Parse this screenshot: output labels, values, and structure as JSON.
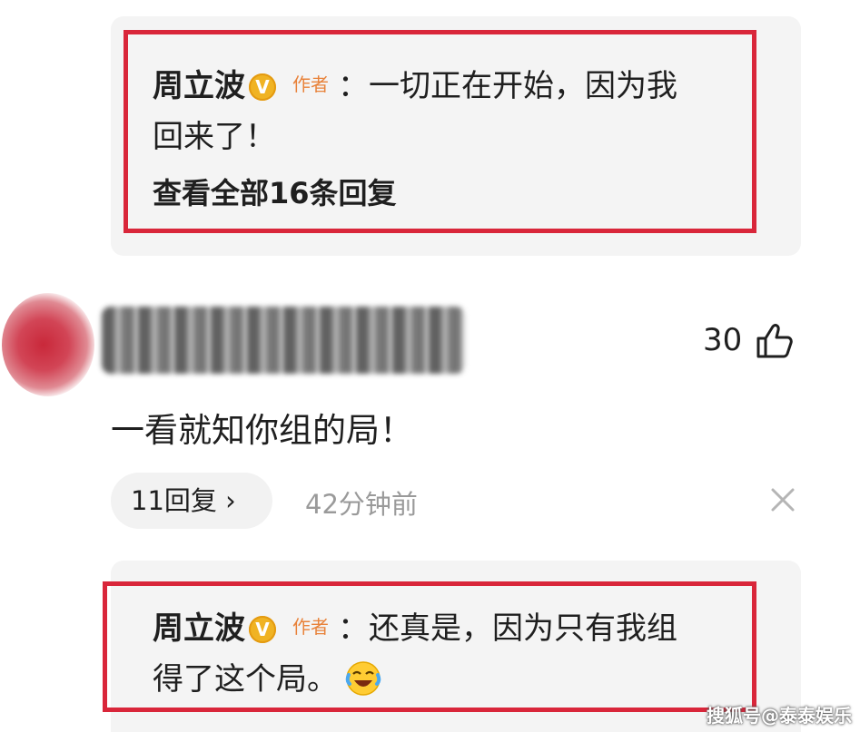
{
  "top_reply": {
    "author": "周立波",
    "author_tag": "作者",
    "text_line1": "：一切正在开始，因为我",
    "text_line2": "回来了！",
    "view_all": "查看全部16条回复"
  },
  "comment": {
    "like_count": "30",
    "text": "一看就知你组的局！",
    "replies_label": "11回复",
    "replies_chevron": "›",
    "time": "42分钟前"
  },
  "bottom_reply": {
    "author": "周立波",
    "author_tag": "作者",
    "text_line1": "：还真是，因为只有我组",
    "text_line2": "得了这个局。",
    "emoji": "laughing-crying-emoji"
  },
  "watermark": "搜狐号@泰泰娱乐",
  "colors": {
    "highlight": "#d9263a",
    "verified": "#f0b323",
    "author_tag": "#e8823a",
    "card_bg": "#f4f4f4"
  }
}
